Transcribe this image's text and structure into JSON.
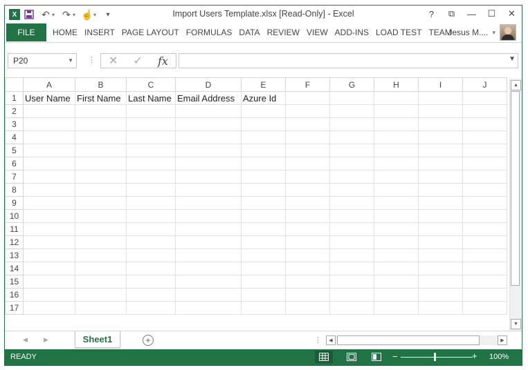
{
  "window": {
    "title": "Import Users Template.xlsx  [Read-Only] - Excel",
    "help_icon": "?",
    "restore_ribbon_icon": "⧉",
    "minimize_icon": "—",
    "maximize_icon": "☐",
    "close_icon": "✕"
  },
  "qat": {
    "app_logo": "X",
    "save_icon": "💾",
    "undo_icon": "↶",
    "redo_icon": "↷",
    "touch_icon": "☝",
    "customize_icon": "▾"
  },
  "ribbon": {
    "file_tab": "FILE",
    "tabs": [
      "HOME",
      "INSERT",
      "PAGE LAYOUT",
      "FORMULAS",
      "DATA",
      "REVIEW",
      "VIEW",
      "ADD-INS",
      "LOAD TEST",
      "TEAM"
    ],
    "user_name": "Jesus M....",
    "user_dropdown": "▾"
  },
  "formula_bar": {
    "name_box": "P20",
    "cancel_icon": "✕",
    "enter_icon": "✓",
    "fx_label": "fx",
    "formula": ""
  },
  "sheet": {
    "columns": [
      "A",
      "B",
      "C",
      "D",
      "E",
      "F",
      "G",
      "H",
      "I",
      "J"
    ],
    "rows": [
      "1",
      "2",
      "3",
      "4",
      "5",
      "6",
      "7",
      "8",
      "9",
      "10",
      "11",
      "12",
      "13",
      "14",
      "15",
      "16",
      "17"
    ],
    "row1": [
      "User Name",
      "First Name",
      "Last Name",
      "Email Address",
      "Azure Id",
      "",
      "",
      "",
      "",
      ""
    ]
  },
  "sheet_tabs": {
    "active": "Sheet1",
    "add_icon": "+"
  },
  "status": {
    "ready": "READY",
    "zoom": "100%",
    "zoom_minus": "−",
    "zoom_plus": "+"
  },
  "colors": {
    "accent": "#217346"
  }
}
